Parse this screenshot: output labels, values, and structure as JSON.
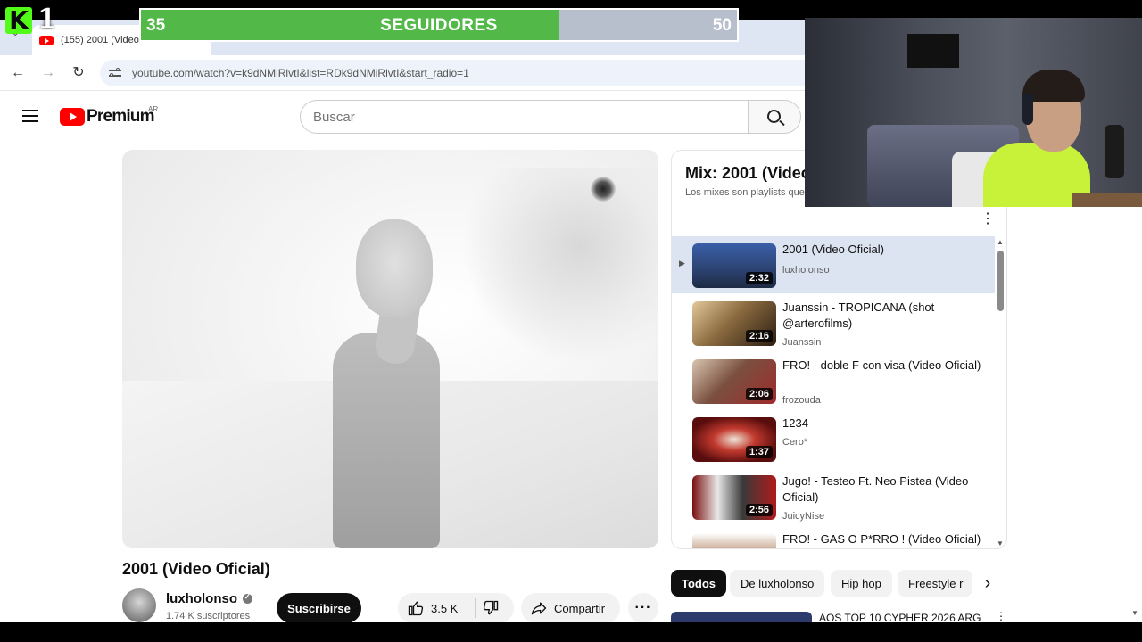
{
  "stream_overlay": {
    "logo_letter": "K",
    "logo_number": "1",
    "goal": {
      "current": 35,
      "target": 50,
      "label": "SEGUIDORES",
      "current_text": "35",
      "target_text": "50",
      "fill_color": "#52b848"
    }
  },
  "browser": {
    "tab_title": "(155) 2001 (Video",
    "url": "youtube.com/watch?v=k9dNMiRlvtI&list=RDk9dNMiRlvtI&start_radio=1"
  },
  "youtube": {
    "logo_text": "Premium",
    "country_code": "AR",
    "search_placeholder": "Buscar",
    "accent_color": "#ff0000"
  },
  "video": {
    "title": "2001 (Video Oficial)",
    "channel": "luxholonso",
    "subscribers": "1.74 K suscriptores",
    "subscribe_label": "Suscribirse",
    "likes": "3.5 K",
    "share_label": "Compartir"
  },
  "playlist": {
    "title": "Mix: 2001 (Video",
    "subtitle": "Los mixes son playlists que",
    "items": [
      {
        "title": "2001 (Video Oficial)",
        "channel": "luxholonso",
        "duration": "2:32",
        "active": true
      },
      {
        "title": "Juanssin - TROPICANA (shot @arterofilms)",
        "channel": "Juanssin",
        "duration": "2:16",
        "active": false
      },
      {
        "title": "FRO! - doble F con visa (Video Oficial)",
        "channel": "frozouda",
        "duration": "2:06",
        "active": false
      },
      {
        "title": "1234",
        "channel": "Cero*",
        "duration": "1:37",
        "active": false
      },
      {
        "title": "Jugo! - Testeo Ft. Neo Pistea (Video Oficial)",
        "channel": "JuicyNise",
        "duration": "2:56",
        "active": false
      },
      {
        "title": "FRO! - GAS O P*RRO ! (Video Oficial)",
        "channel": "",
        "duration": "",
        "active": false
      }
    ]
  },
  "chips": [
    "Todos",
    "De luxholonso",
    "Hip hop",
    "Freestyle r"
  ],
  "recommendation": {
    "title": "AOS TOP 10 CYPHER 2026 ARG"
  }
}
